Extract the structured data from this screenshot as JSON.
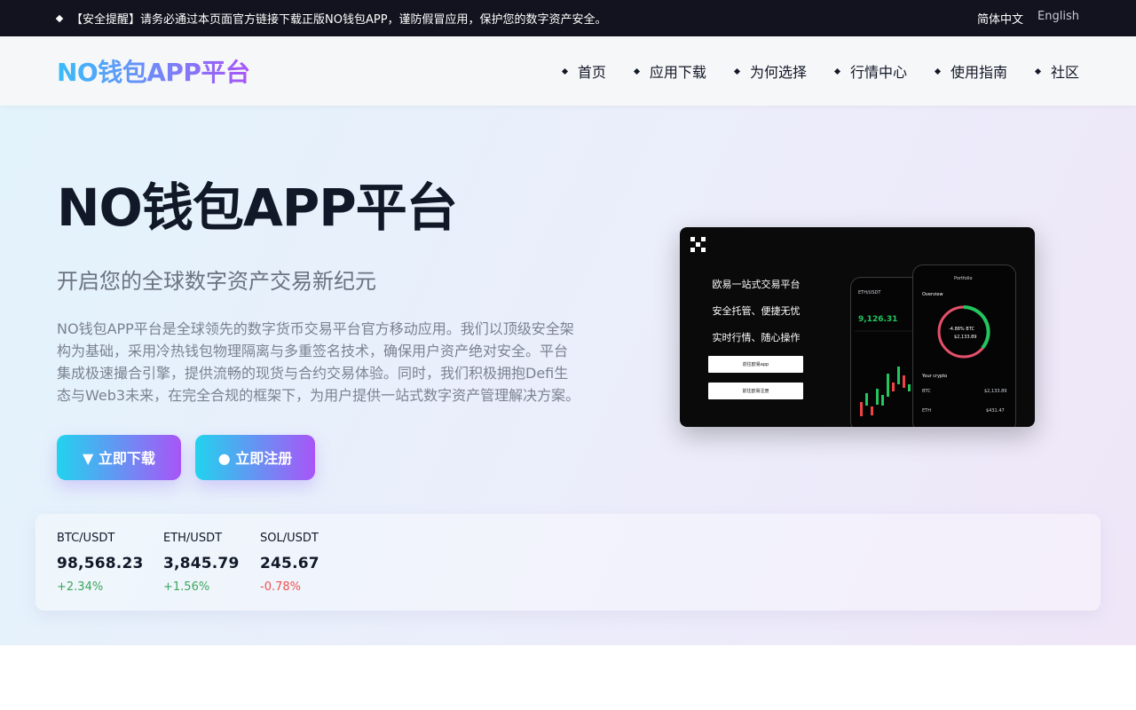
{
  "topbar": {
    "notice": "【安全提醒】请务必通过本页面官方链接下载正版NO钱包APP，谨防假冒应用，保护您的数字资产安全。",
    "lang_zh": "简体中文",
    "lang_en": "English"
  },
  "header": {
    "logo": "NO钱包APP平台",
    "nav": [
      "首页",
      "应用下载",
      "为何选择",
      "行情中心",
      "使用指南",
      "社区"
    ]
  },
  "hero": {
    "title": "NO钱包APP平台",
    "subtitle": "开启您的全球数字资产交易新纪元",
    "description": "NO钱包APP平台是全球领先的数字货币交易平台官方移动应用。我们以顶级安全架构为基础，采用冷热钱包物理隔离与多重签名技术，确保用户资产绝对安全。平台集成极速撮合引擎，提供流畅的现货与合约交易体验。同时，我们积极拥抱Defi生态与Web3未来，在完全合规的框架下，为用户提供一站式数字资产管理解决方案。",
    "download_label": "▼ 立即下载",
    "register_label": "● 立即注册"
  },
  "promo": {
    "lines": [
      "欧易一站式交易平台",
      "安全托管、便捷无忧",
      "实时行情、随心操作"
    ],
    "btn1": "前往欧易app",
    "btn2": "前往欧易注册",
    "back_pair": "ETH/USDT",
    "back_price": "9,126.31",
    "front_header": "Portfolio",
    "front_overview": "Overview",
    "front_pct": "-4.88% BTC",
    "front_value": "$2,133.89",
    "front_your_crypto": "Your crypto",
    "front_btc": "BTC",
    "front_btc_val": "$2,133.89",
    "front_eth": "ETH",
    "front_eth_val": "$431.47"
  },
  "ticker": [
    {
      "pair": "BTC/USDT",
      "price": "98,568.23",
      "change": "+2.34%",
      "direction": "up"
    },
    {
      "pair": "ETH/USDT",
      "price": "3,845.79",
      "change": "+1.56%",
      "direction": "up"
    },
    {
      "pair": "SOL/USDT",
      "price": "245.67",
      "change": "-0.78%",
      "direction": "down"
    }
  ],
  "colors": {
    "topbar_bg": "#13131f",
    "gradient_start": "#22d3ee",
    "gradient_end": "#a855f7",
    "positive": "#3ca65c",
    "negative": "#ef5350"
  }
}
